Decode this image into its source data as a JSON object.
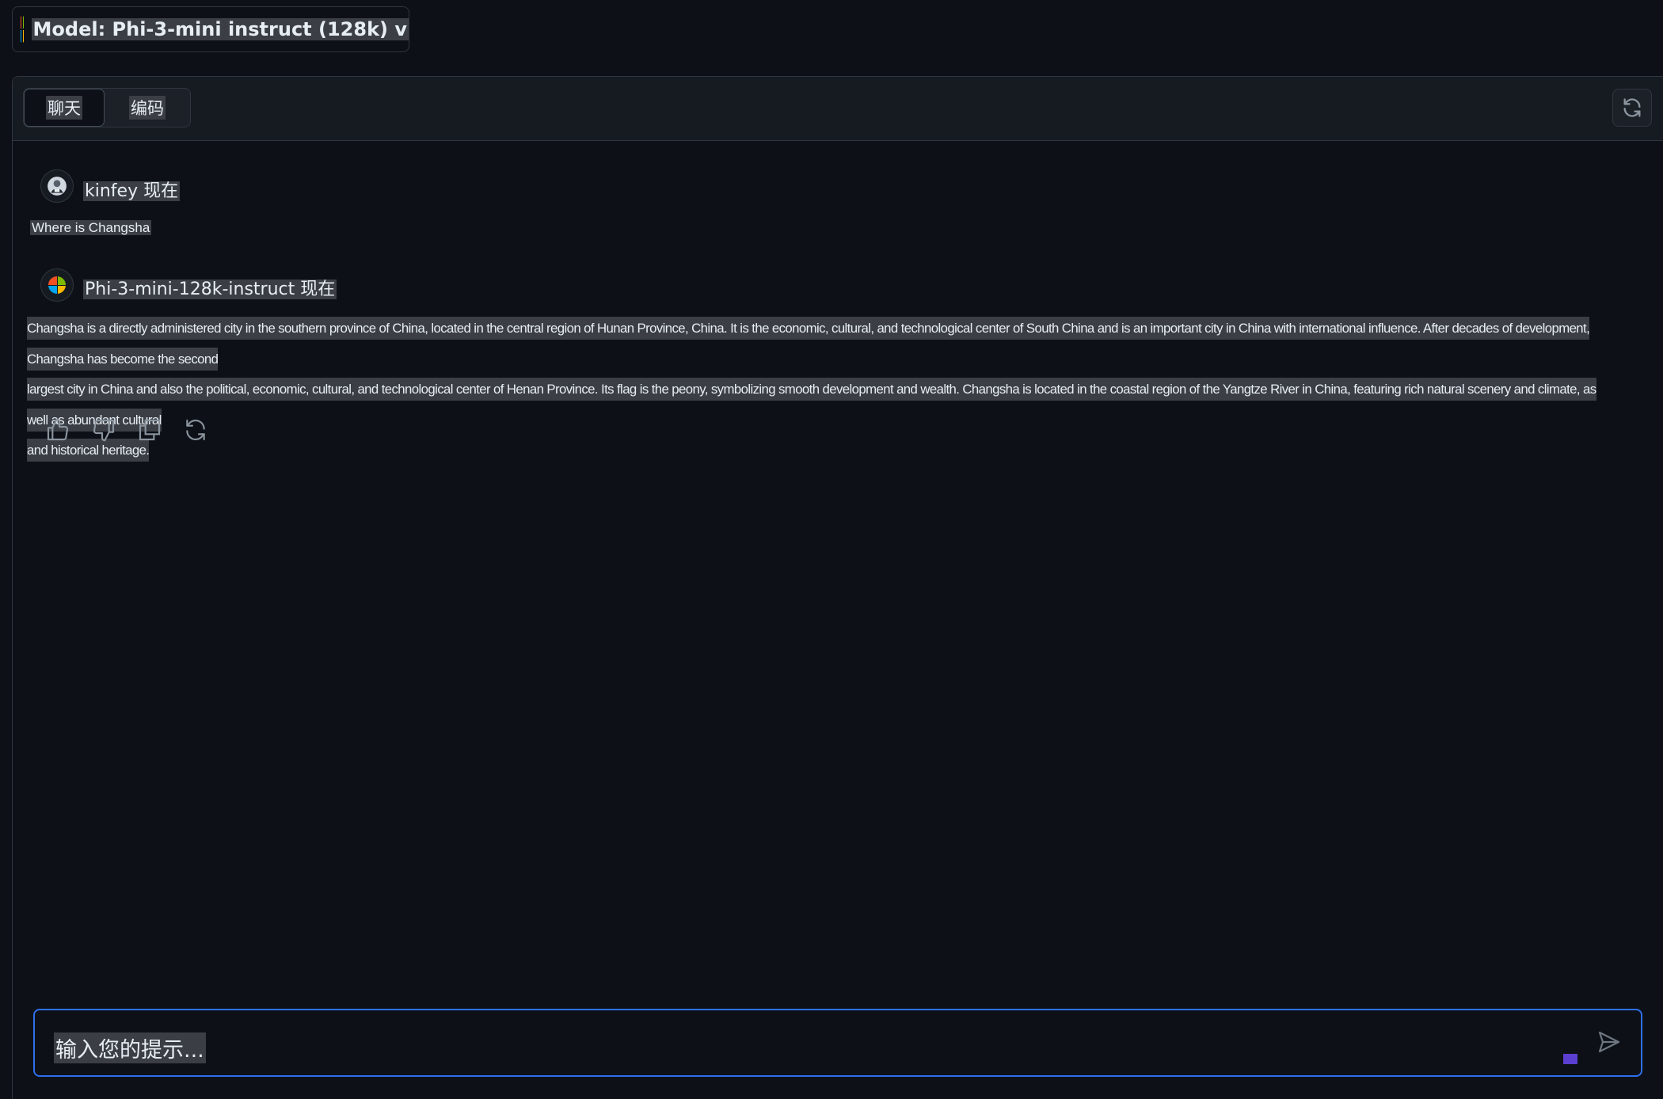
{
  "model_picker": {
    "label": "Model: Phi-3-mini instruct (128k) v"
  },
  "brand_colors": {
    "red": "#f25022",
    "green": "#7fba00",
    "blue": "#00a4ef",
    "yellow": "#ffb900",
    "accent": "#2f6fed"
  },
  "tabs": [
    {
      "label": "聊天",
      "active": true
    },
    {
      "label": "编码",
      "active": false
    }
  ],
  "header": {
    "refresh_icon": "refresh-icon"
  },
  "messages": [
    {
      "sender": "kinfey 现在",
      "role": "user",
      "avatar_icon": "user-avatar-icon",
      "text": "Where is Changsha"
    },
    {
      "sender": "Phi-3-mini-128k-instruct 现在",
      "role": "assistant",
      "avatar_icon": "microsoft-logo-icon",
      "lines": [
        "Changsha is a directly administered city in the southern province of China, located in the central region of Hunan Province, China. It is the economic, cultural, and technological center of South China and is an important city in China with international influence. After decades of development, Changsha has become the second",
        "largest city in China and also the political, economic, cultural, and technological center of Henan Province. Its flag is the peony, symbolizing smooth development and wealth. Changsha is located in the coastal region of the Yangtze River in China, featuring rich natural scenery and climate, as well as abundant cultural",
        "and historical heritage."
      ]
    }
  ],
  "message_actions": [
    "thumbs-up-icon",
    "thumbs-down-icon",
    "copy-icon",
    "regenerate-icon"
  ],
  "prompt": {
    "placeholder": "输入您的提示...",
    "send_icon": "send-icon"
  }
}
